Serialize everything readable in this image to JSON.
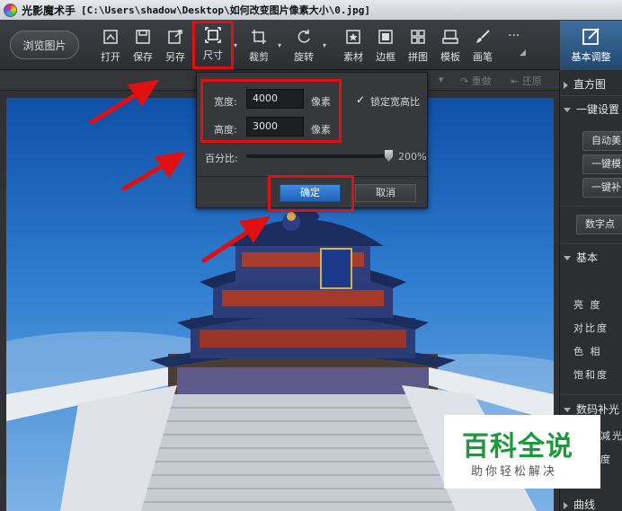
{
  "window": {
    "app_name": "光影魔术手",
    "file_path": "[C:\\Users\\shadow\\Desktop\\如何改变图片像素大小\\0.jpg]"
  },
  "toolbar": {
    "browse_label": "浏览图片",
    "tools": [
      {
        "label": "打开",
        "icon": "open-icon"
      },
      {
        "label": "保存",
        "icon": "save-icon"
      },
      {
        "label": "另存",
        "icon": "save-as-icon"
      },
      {
        "label": "尺寸",
        "icon": "resize-icon"
      },
      {
        "label": "裁剪",
        "icon": "crop-icon"
      },
      {
        "label": "旋转",
        "icon": "rotate-icon"
      },
      {
        "label": "素材",
        "icon": "material-icon"
      },
      {
        "label": "边框",
        "icon": "frame-icon"
      },
      {
        "label": "拼图",
        "icon": "puzzle-icon"
      },
      {
        "label": "模板",
        "icon": "template-icon"
      },
      {
        "label": "画笔",
        "icon": "brush-icon"
      }
    ],
    "more_label": "...",
    "active_tab_label": "基本调整"
  },
  "subbar": {
    "redo_label": "重做",
    "restore_label": "还原"
  },
  "dialog": {
    "width_label": "宽度:",
    "width_value": "4000",
    "height_label": "高度:",
    "height_value": "3000",
    "unit": "像素",
    "lock_label": "锁定宽高比",
    "lock_checked": true,
    "percent_label": "百分比:",
    "percent_value": "200%",
    "ok_label": "确定",
    "cancel_label": "取消"
  },
  "right_panel": {
    "histogram": "直方图",
    "one_click": "一键设置",
    "auto_btn": "自动美",
    "one_click_btn": "一键模",
    "one_click_fill": "一键补",
    "digital_btn": "数字点",
    "basic": "基本",
    "brightness": "亮 度",
    "contrast": "对比度",
    "hue": "色 相",
    "saturation": "饱和度",
    "digital_fill": "数码补光",
    "dim_label": "减光",
    "deg_label": "度",
    "curve": "曲线"
  },
  "watermark": {
    "main": "百科全说",
    "sub": "助你轻松解决"
  },
  "colors": {
    "accent_blue": "#2f72c8",
    "highlight_red": "#e01010",
    "watermark_green": "#1a9a3a"
  }
}
